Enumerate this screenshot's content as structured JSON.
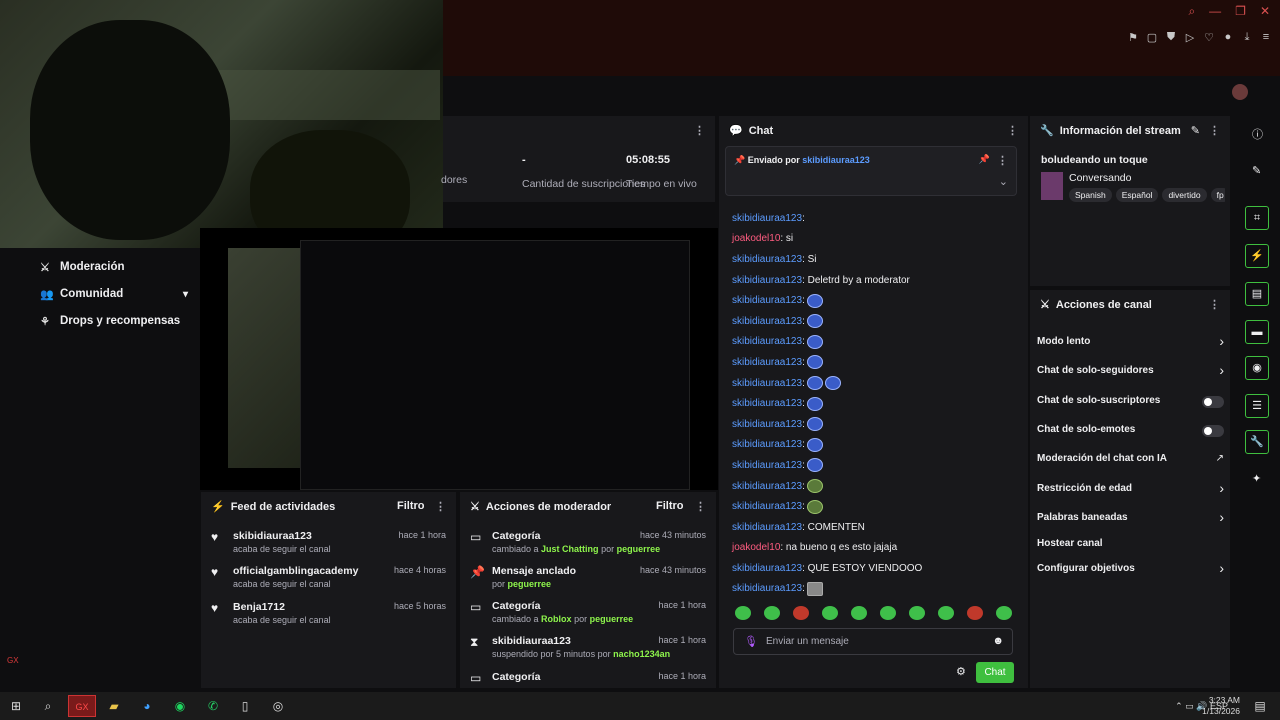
{
  "stats": {
    "suscripciones_value": "-",
    "suscripciones_label": "Cantidad de suscripciones",
    "tiempo_value": "05:08:55",
    "tiempo_label": "Tiempo en vivo",
    "seguidores_partial": "dores"
  },
  "nav": [
    {
      "label": "Moderación",
      "icon": "sword-icon"
    },
    {
      "label": "Comunidad",
      "icon": "users-icon"
    },
    {
      "label": "Drops y recompensas",
      "icon": "gift-icon"
    }
  ],
  "gx_label": "GX",
  "feed": {
    "title": "Feed de actividades",
    "filter": "Filtro",
    "items": [
      {
        "user": "skibidiauraa123",
        "text": "acaba de seguir el canal",
        "time": "hace 1 hora"
      },
      {
        "user": "officialgamblingacademy",
        "text": "acaba de seguir el canal",
        "time": "hace 4 horas"
      },
      {
        "user": "Benja1712",
        "text": "acaba de seguir el canal",
        "time": "hace 5 horas"
      }
    ]
  },
  "modactions": {
    "title": "Acciones de moderador",
    "filter": "Filtro",
    "items": [
      {
        "title": "Categoría",
        "pre": "cambiado a",
        "highlight": "Just Chatting",
        "mid": "por",
        "actor": "peguerree",
        "time": "hace 43 minutos"
      },
      {
        "title": "Mensaje anclado",
        "pre": "por",
        "highlight": "",
        "mid": "",
        "actor": "peguerree",
        "time": "hace 43 minutos"
      },
      {
        "title": "Categoría",
        "pre": "cambiado a",
        "highlight": "Roblox",
        "mid": "por",
        "actor": "peguerree",
        "time": "hace 1 hora"
      },
      {
        "title": "skibidiauraa123",
        "pre": "suspendido por 5 minutos por",
        "highlight": "",
        "mid": "",
        "actor": "nacho1234an",
        "time": "hace 1 hora"
      },
      {
        "title": "Categoría",
        "pre": "",
        "highlight": "",
        "mid": "",
        "actor": "",
        "time": "hace 1 hora"
      }
    ]
  },
  "chat": {
    "title": "Chat",
    "pinned_prefix": "Enviado por",
    "pinned_user": "skibidiauraa123",
    "placeholder": "Enviar un mensaje",
    "send": "Chat",
    "messages": [
      {
        "user": "skibidiauraa123",
        "color": "b",
        "text": ":",
        "emotes": 0
      },
      {
        "user": "joakodel10",
        "color": "r",
        "text": ": si",
        "emotes": 0
      },
      {
        "user": "skibidiauraa123",
        "color": "b",
        "text": ": Si",
        "emotes": 0
      },
      {
        "user": "skibidiauraa123",
        "color": "b",
        "text": ": Deletrd by a moderator",
        "emotes": 0
      },
      {
        "user": "skibidiauraa123",
        "color": "b",
        "text": ":",
        "emotes": 1
      },
      {
        "user": "skibidiauraa123",
        "color": "b",
        "text": ":",
        "emotes": 1
      },
      {
        "user": "skibidiauraa123",
        "color": "b",
        "text": ":",
        "emotes": 1
      },
      {
        "user": "skibidiauraa123",
        "color": "b",
        "text": ":",
        "emotes": 1
      },
      {
        "user": "skibidiauraa123",
        "color": "b",
        "text": ":",
        "emotes": 2
      },
      {
        "user": "skibidiauraa123",
        "color": "b",
        "text": ":",
        "emotes": 1
      },
      {
        "user": "skibidiauraa123",
        "color": "b",
        "text": ":",
        "emotes": 1
      },
      {
        "user": "skibidiauraa123",
        "color": "b",
        "text": ":",
        "emotes": 1
      },
      {
        "user": "skibidiauraa123",
        "color": "b",
        "text": ":",
        "emotes": 1
      },
      {
        "user": "skibidiauraa123",
        "color": "b",
        "text": ":",
        "emotes": 1
      },
      {
        "user": "skibidiauraa123",
        "color": "b",
        "text": ":",
        "emotes": 1
      },
      {
        "user": "skibidiauraa123",
        "color": "b",
        "text": ": COMENTEN",
        "emotes": 0
      },
      {
        "user": "joakodel10",
        "color": "r",
        "text": ": na bueno q es esto jajaja",
        "emotes": 0
      },
      {
        "user": "skibidiauraa123",
        "color": "b",
        "text": ": QUE ESTOY VIENDOOO",
        "emotes": 0
      },
      {
        "user": "skibidiauraa123",
        "color": "b",
        "text": ":",
        "emotes": 1
      }
    ]
  },
  "info": {
    "title": "Información del stream",
    "stream_title": "boludeando un toque",
    "category": "Conversando",
    "tags": [
      "Spanish",
      "Español",
      "divertido",
      "fp"
    ]
  },
  "channel": {
    "title": "Acciones de canal",
    "items": [
      {
        "label": "Modo lento",
        "ctrl": "chevron"
      },
      {
        "label": "Chat de solo-seguidores",
        "ctrl": "chevron"
      },
      {
        "label": "Chat de solo-suscriptores",
        "ctrl": "toggle"
      },
      {
        "label": "Chat de solo-emotes",
        "ctrl": "toggle"
      },
      {
        "label": "Moderación del chat con IA",
        "ctrl": "external"
      },
      {
        "label": "Restricción de edad",
        "ctrl": "chevron"
      },
      {
        "label": "Palabras baneadas",
        "ctrl": "chevron"
      },
      {
        "label": "Hostear canal",
        "ctrl": "none"
      },
      {
        "label": "Configurar objetivos",
        "ctrl": "chevron"
      }
    ]
  },
  "taskbar": {
    "lang": "ESP",
    "time": "3:23 AM",
    "date": "1/13/2026"
  }
}
